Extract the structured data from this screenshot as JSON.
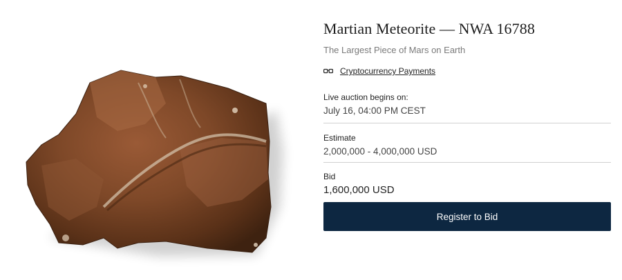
{
  "lot": {
    "title": "Martian Meteorite — NWA 16788",
    "subtitle": "The Largest Piece of Mars on Earth",
    "image_icon": "meteorite-image"
  },
  "payment": {
    "icon": "crypto-glasses-icon",
    "label": "Cryptocurrency Payments"
  },
  "auction": {
    "begins_label": "Live auction begins on:",
    "begins_value": "July 16, 04:00 PM CEST"
  },
  "estimate": {
    "label": "Estimate",
    "value": "2,000,000 - 4,000,000 USD"
  },
  "bid": {
    "label": "Bid",
    "value": "1,600,000 USD"
  },
  "actions": {
    "register_label": "Register to Bid"
  },
  "colors": {
    "button_bg": "#0d2741",
    "divider": "#d0d0d0"
  }
}
